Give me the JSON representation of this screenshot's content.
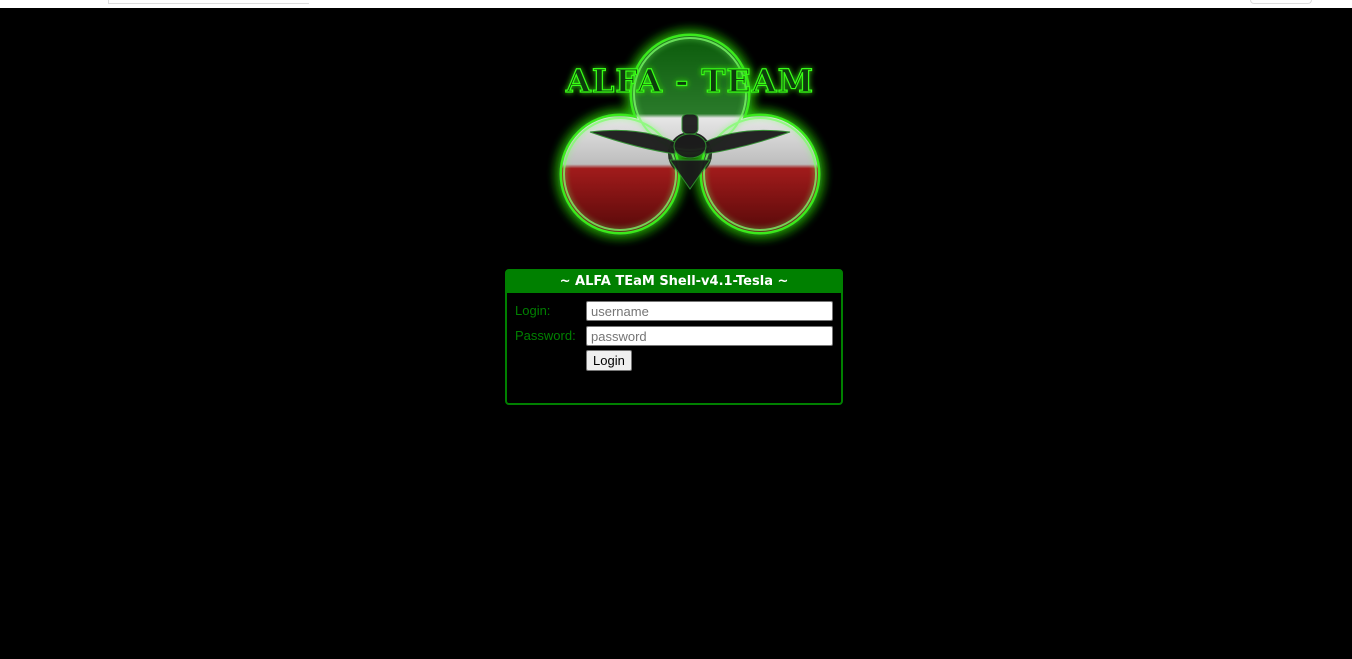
{
  "logo": {
    "text": "ALFA - TEAM",
    "glow_color": "#39ff14"
  },
  "login_panel": {
    "title": "~ ALFA TEaM Shell-v4.1-Tesla ~",
    "login_label": "Login:",
    "password_label": "Password:",
    "username_placeholder": "username",
    "password_placeholder": "password",
    "submit_label": "Login"
  },
  "colors": {
    "background": "#000000",
    "accent": "#008000",
    "header_text": "#ffffff"
  }
}
